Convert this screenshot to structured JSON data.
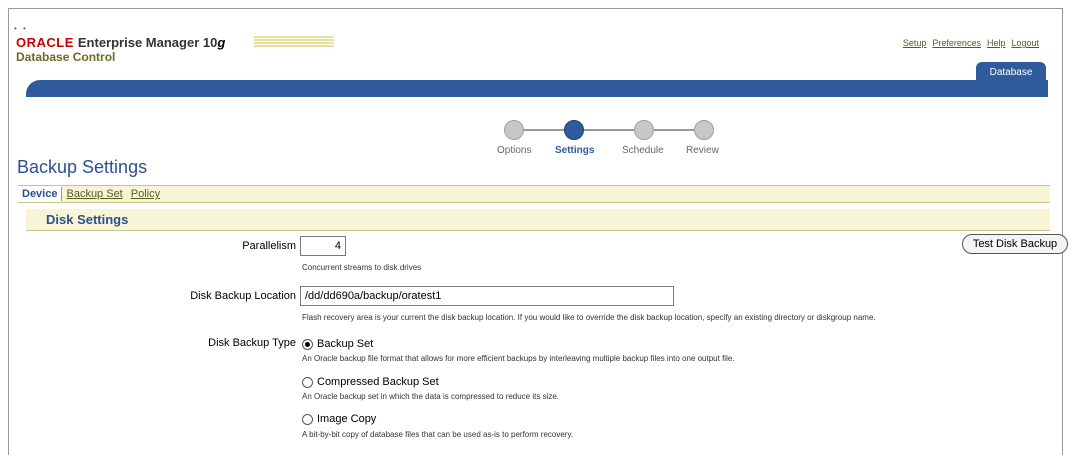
{
  "header": {
    "logo_oracle": "ORACLE",
    "logo_product": "Enterprise Manager 10",
    "logo_version": "g",
    "logo_subtitle": "Database Control",
    "global_links": [
      "Setup",
      "Preferences",
      "Help",
      "Logout"
    ],
    "tab": "Database"
  },
  "train": {
    "steps": [
      "Options",
      "Settings",
      "Schedule",
      "Review"
    ],
    "current_step": "Settings"
  },
  "page_title": "Backup Settings",
  "subtabs": {
    "device": "Device",
    "backup_set": "Backup Set",
    "policy": "Policy"
  },
  "section_title": "Disk Settings",
  "form": {
    "parallelism_label": "Parallelism",
    "parallelism_value": "4",
    "parallelism_tip": "Concurrent streams to disk drives",
    "location_label": "Disk Backup Location",
    "location_value": "/dd/dd690a/backup/oratest1",
    "location_tip": "Flash recovery area is your current the disk backup location. If you would like to override the disk backup location, specify an existing directory or diskgroup name.",
    "type_label": "Disk Backup Type",
    "test_button": "Test Disk Backup",
    "options": [
      {
        "label": "Backup Set",
        "desc": "An Oracle backup file format that allows for more efficient backups by interleaving multiple backup files into one output file.",
        "checked": true
      },
      {
        "label": "Compressed Backup Set",
        "desc": "An Oracle backup set in which the data is compressed to reduce its size.",
        "checked": false
      },
      {
        "label": "Image Copy",
        "desc": "A bit-by-bit copy of database files that can be used as-is to perform recovery.",
        "checked": false
      }
    ]
  },
  "colors": {
    "accent_blue": "#2f5b9c",
    "oracle_red": "#cc0000",
    "band_beige": "#f7f5d6"
  }
}
